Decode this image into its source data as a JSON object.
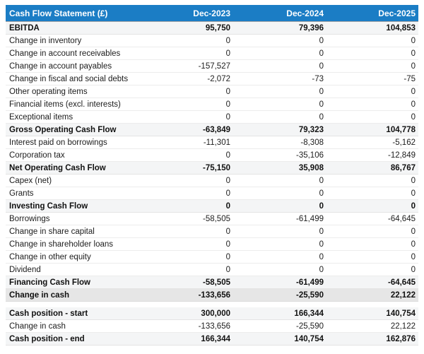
{
  "colors": {
    "header_bg": "#1b7dc5",
    "header_text": "#ffffff",
    "subtotal_row_bg": "#f4f5f6",
    "total_row_bg": "#e6e6e6",
    "body_text": "#1c1c1c"
  },
  "chart_data": {
    "type": "table",
    "title": "Cash Flow Statement (£)",
    "columns": [
      "Dec-2023",
      "Dec-2024",
      "Dec-2025"
    ],
    "rows": [
      {
        "label": "EBITDA",
        "values": [
          "95,750",
          "79,396",
          "104,853"
        ],
        "emphasis": true
      },
      {
        "label": "Change in inventory",
        "values": [
          "0",
          "0",
          "0"
        ],
        "emphasis": false
      },
      {
        "label": "Change in account receivables",
        "values": [
          "0",
          "0",
          "0"
        ],
        "emphasis": false
      },
      {
        "label": "Change in account payables",
        "values": [
          "-157,527",
          "0",
          "0"
        ],
        "emphasis": false
      },
      {
        "label": "Change in fiscal and social debts",
        "values": [
          "-2,072",
          "-73",
          "-75"
        ],
        "emphasis": false
      },
      {
        "label": "Other operating items",
        "values": [
          "0",
          "0",
          "0"
        ],
        "emphasis": false
      },
      {
        "label": "Financial items (excl. interests)",
        "values": [
          "0",
          "0",
          "0"
        ],
        "emphasis": false
      },
      {
        "label": "Exceptional items",
        "values": [
          "0",
          "0",
          "0"
        ],
        "emphasis": false
      },
      {
        "label": "Gross Operating Cash Flow",
        "values": [
          "-63,849",
          "79,323",
          "104,778"
        ],
        "emphasis": true
      },
      {
        "label": "Interest paid on borrowings",
        "values": [
          "-11,301",
          "-8,308",
          "-5,162"
        ],
        "emphasis": false
      },
      {
        "label": "Corporation tax",
        "values": [
          "0",
          "-35,106",
          "-12,849"
        ],
        "emphasis": false
      },
      {
        "label": "Net Operating Cash Flow",
        "values": [
          "-75,150",
          "35,908",
          "86,767"
        ],
        "emphasis": true
      },
      {
        "label": "Capex (net)",
        "values": [
          "0",
          "0",
          "0"
        ],
        "emphasis": false
      },
      {
        "label": "Grants",
        "values": [
          "0",
          "0",
          "0"
        ],
        "emphasis": false
      },
      {
        "label": "Investing Cash Flow",
        "values": [
          "0",
          "0",
          "0"
        ],
        "emphasis": true
      },
      {
        "label": "Borrowings",
        "values": [
          "-58,505",
          "-61,499",
          "-64,645"
        ],
        "emphasis": false
      },
      {
        "label": "Change in share capital",
        "values": [
          "0",
          "0",
          "0"
        ],
        "emphasis": false
      },
      {
        "label": "Change in shareholder loans",
        "values": [
          "0",
          "0",
          "0"
        ],
        "emphasis": false
      },
      {
        "label": "Change in other equity",
        "values": [
          "0",
          "0",
          "0"
        ],
        "emphasis": false
      },
      {
        "label": "Dividend",
        "values": [
          "0",
          "0",
          "0"
        ],
        "emphasis": false
      },
      {
        "label": "Financing Cash Flow",
        "values": [
          "-58,505",
          "-61,499",
          "-64,645"
        ],
        "emphasis": true
      },
      {
        "label": "Change in cash",
        "values": [
          "-133,656",
          "-25,590",
          "22,122"
        ],
        "emphasis": true
      },
      {
        "label": "Cash position - start",
        "values": [
          "300,000",
          "166,344",
          "140,754"
        ],
        "emphasis": true
      },
      {
        "label": "Change in cash",
        "values": [
          "-133,656",
          "-25,590",
          "22,122"
        ],
        "emphasis": false
      },
      {
        "label": "Cash position - end",
        "values": [
          "166,344",
          "140,754",
          "162,876"
        ],
        "emphasis": true
      }
    ]
  }
}
